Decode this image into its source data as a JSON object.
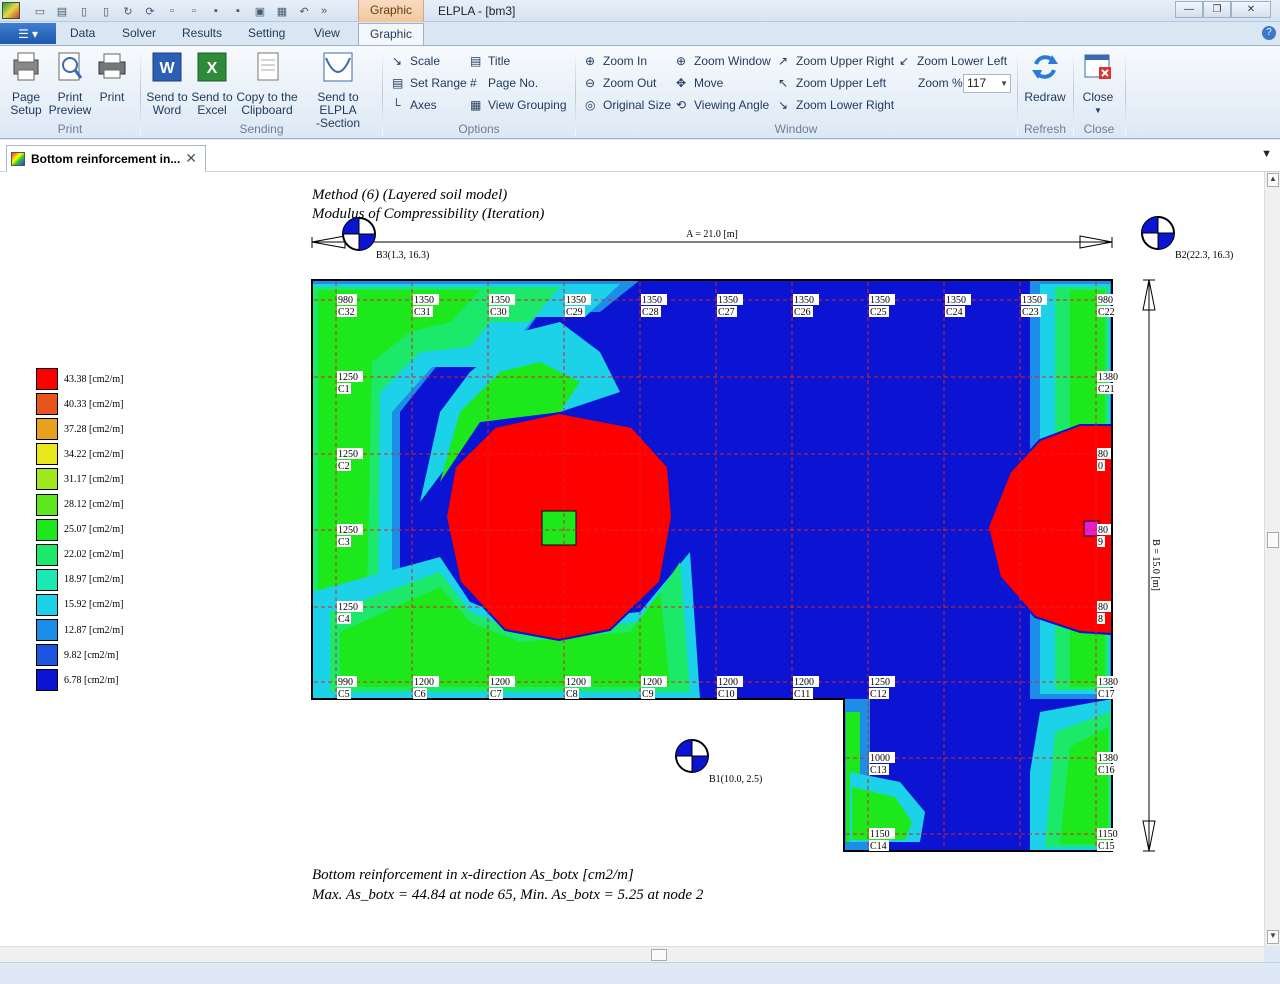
{
  "window": {
    "title": "ELPLA - [bm3]",
    "context_tab": "Graphic"
  },
  "menu": {
    "tabs": [
      "Data",
      "Solver",
      "Results",
      "Setting",
      "View",
      "Graphic"
    ]
  },
  "ribbon": {
    "print": {
      "label": "Print",
      "page_setup": [
        "Page",
        "Setup"
      ],
      "print_preview": [
        "Print",
        "Preview"
      ],
      "print": "Print"
    },
    "sending": {
      "label": "Sending",
      "send_word": [
        "Send to",
        "Word"
      ],
      "send_excel": [
        "Send to",
        "Excel"
      ],
      "copy_clipboard": [
        "Copy to the",
        "Clipboard"
      ],
      "send_elpla": [
        "Send to ELPLA",
        "-Section"
      ]
    },
    "options": {
      "label": "Options",
      "scale": "Scale",
      "set_range": "Set Range",
      "axes": "Axes",
      "title": "Title",
      "page_no": "Page No.",
      "view_grouping": "View Grouping"
    },
    "window": {
      "label": "Window",
      "zoom_in": "Zoom In",
      "zoom_out": "Zoom Out",
      "original_size": "Original Size",
      "zoom_window": "Zoom Window",
      "move": "Move",
      "viewing_angle": "Viewing Angle",
      "zoom_upper_right": "Zoom Upper Right",
      "zoom_upper_left": "Zoom Upper Left",
      "zoom_lower_right": "Zoom Lower Right",
      "zoom_lower_left": "Zoom Lower Left",
      "zoom_percent_label": "Zoom %",
      "zoom_percent_value": "117"
    },
    "refresh": {
      "label": "Refresh",
      "redraw": "Redraw"
    },
    "close": {
      "label": "Close",
      "close": "Close"
    }
  },
  "document_tab": {
    "title": "Bottom reinforcement in..."
  },
  "drawing": {
    "method": "Method (6) (Layered soil model)",
    "modulus": "Modulus of Compressibility (Iteration)",
    "dim_a": "A = 21.0 [m]",
    "dim_b": "B = 15.0 [m]",
    "boreholes": [
      "B3(1.3, 16.3)",
      "B2(22.3, 16.3)",
      "B1(10.0, 2.5)"
    ],
    "caption_1": "Bottom reinforcement in x-direction As_botx [cm2/m]",
    "caption_2": "Max. As_botx = 44.84 at node 65, Min. As_botx = 5.25 at node 2",
    "legend": [
      {
        "value": "43.38 [cm2/m]",
        "color": "#ff0000"
      },
      {
        "value": "40.33 [cm2/m]",
        "color": "#e8551c"
      },
      {
        "value": "37.28 [cm2/m]",
        "color": "#e8a11c"
      },
      {
        "value": "34.22 [cm2/m]",
        "color": "#e8e81c"
      },
      {
        "value": "31.17 [cm2/m]",
        "color": "#a0e81c"
      },
      {
        "value": "28.12 [cm2/m]",
        "color": "#5ce81c"
      },
      {
        "value": "25.07 [cm2/m]",
        "color": "#1ce81c"
      },
      {
        "value": "22.02 [cm2/m]",
        "color": "#1ce86a"
      },
      {
        "value": "18.97 [cm2/m]",
        "color": "#1ce8b4"
      },
      {
        "value": "15.92 [cm2/m]",
        "color": "#1cd2e8"
      },
      {
        "value": "12.87 [cm2/m]",
        "color": "#1c8ee8"
      },
      {
        "value": "9.82  [cm2/m]",
        "color": "#1c55e0"
      },
      {
        "value": "6.78  [cm2/m]",
        "color": "#0a14d2"
      }
    ],
    "columns_top": [
      {
        "v": "980",
        "n": "C32"
      },
      {
        "v": "1350",
        "n": "C31"
      },
      {
        "v": "1350",
        "n": "C30"
      },
      {
        "v": "1350",
        "n": "C29"
      },
      {
        "v": "1350",
        "n": "C28"
      },
      {
        "v": "1350",
        "n": "C27"
      },
      {
        "v": "1350",
        "n": "C26"
      },
      {
        "v": "1350",
        "n": "C25"
      },
      {
        "v": "1350",
        "n": "C24"
      },
      {
        "v": "1350",
        "n": "C23"
      },
      {
        "v": "980",
        "n": "C22"
      }
    ],
    "columns_left": [
      {
        "v": "1250",
        "n": "C1"
      },
      {
        "v": "1250",
        "n": "C2"
      },
      {
        "v": "1250",
        "n": "C3"
      },
      {
        "v": "1250",
        "n": "C4"
      }
    ],
    "columns_bottom": [
      {
        "v": "990",
        "n": "C5"
      },
      {
        "v": "1200",
        "n": "C6"
      },
      {
        "v": "1200",
        "n": "C7"
      },
      {
        "v": "1200",
        "n": "C8"
      },
      {
        "v": "1200",
        "n": "C9"
      },
      {
        "v": "1200",
        "n": "C10"
      },
      {
        "v": "1200",
        "n": "C11"
      },
      {
        "v": "1250",
        "n": "C12"
      },
      {
        "v": "1380",
        "n": "C17"
      }
    ],
    "columns_right": [
      {
        "v": "1380",
        "n": "C21"
      },
      {
        "v": "80",
        "n": "0"
      },
      {
        "v": "80",
        "n": "9"
      },
      {
        "v": "80",
        "n": "8"
      }
    ],
    "columns_ext": [
      {
        "v": "1000",
        "n": "C13"
      },
      {
        "v": "1150",
        "n": "C14"
      },
      {
        "v": "1380",
        "n": "C16"
      },
      {
        "v": "1150",
        "n": "C15"
      }
    ]
  }
}
